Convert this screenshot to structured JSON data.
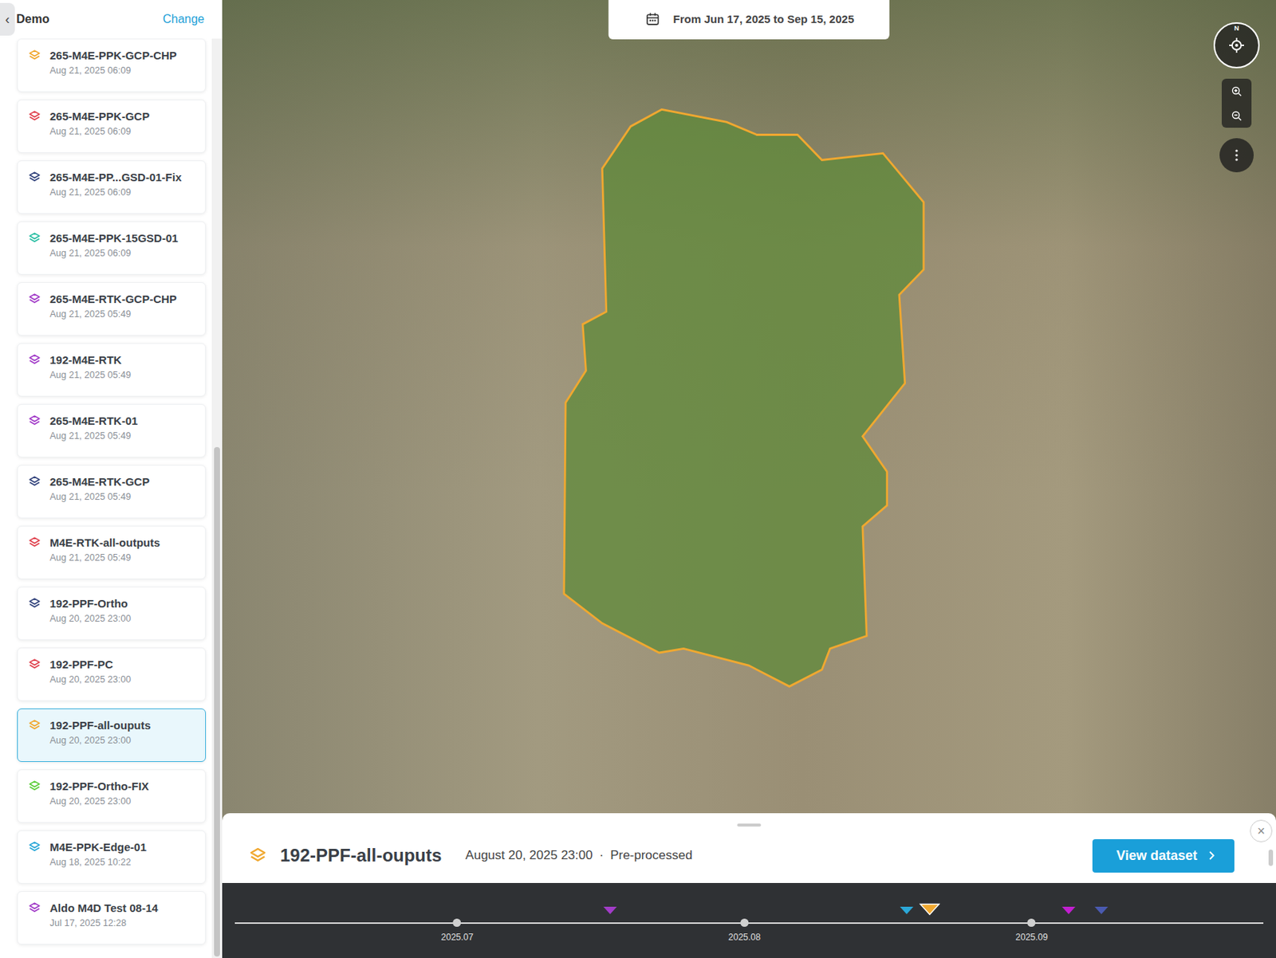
{
  "sidebar": {
    "title": "Demo",
    "action": "Change",
    "collapse": "‹"
  },
  "datasets": [
    {
      "title": "265-M4E-PPK-GCP-CHP",
      "date": "Aug 21, 2025 06:09",
      "color": "#f0a830",
      "selected": false
    },
    {
      "title": "265-M4E-PPK-GCP",
      "date": "Aug 21, 2025 06:09",
      "color": "#e0434f",
      "selected": false
    },
    {
      "title": "265-M4E-PP...GSD-01-Fix",
      "date": "Aug 21, 2025 06:09",
      "color": "#34457d",
      "selected": false
    },
    {
      "title": "265-M4E-PPK-15GSD-01",
      "date": "Aug 21, 2025 06:09",
      "color": "#2bbfa4",
      "selected": false
    },
    {
      "title": "265-M4E-RTK-GCP-CHP",
      "date": "Aug 21, 2025 05:49",
      "color": "#a23cc8",
      "selected": false
    },
    {
      "title": "192-M4E-RTK",
      "date": "Aug 21, 2025 05:49",
      "color": "#a23cc8",
      "selected": false
    },
    {
      "title": "265-M4E-RTK-01",
      "date": "Aug 21, 2025 05:49",
      "color": "#a23cc8",
      "selected": false
    },
    {
      "title": "265-M4E-RTK-GCP",
      "date": "Aug 21, 2025 05:49",
      "color": "#34457d",
      "selected": false
    },
    {
      "title": "M4E-RTK-all-outputs",
      "date": "Aug 21, 2025 05:49",
      "color": "#e0434f",
      "selected": false
    },
    {
      "title": "192-PPF-Ortho",
      "date": "Aug 20, 2025 23:00",
      "color": "#34457d",
      "selected": false
    },
    {
      "title": "192-PPF-PC",
      "date": "Aug 20, 2025 23:00",
      "color": "#e0434f",
      "selected": false
    },
    {
      "title": "192-PPF-all-ouputs",
      "date": "Aug 20, 2025 23:00",
      "color": "#f0a830",
      "selected": true
    },
    {
      "title": "192-PPF-Ortho-FIX",
      "date": "Aug 20, 2025 23:00",
      "color": "#5fcf3c",
      "selected": false
    },
    {
      "title": "M4E-PPK-Edge-01",
      "date": "Aug 18, 2025 10:22",
      "color": "#2ba8d8",
      "selected": false
    },
    {
      "title": "Aldo M4D Test 08-14",
      "date": "Jul 17, 2025 12:28",
      "color": "#a23cc8",
      "selected": false
    }
  ],
  "date_range": "From Jun 17, 2025 to Sep 15, 2025",
  "compass": "N",
  "detail": {
    "title": "192-PPF-all-ouputs",
    "date": "August 20, 2025 23:00",
    "separator": "·",
    "status": "Pre-processed",
    "button": "View dataset",
    "close": "×",
    "color": "#f0a830"
  },
  "timeline": {
    "span_days": 111,
    "ticks": [
      {
        "label": "2025.07",
        "day": 24
      },
      {
        "label": "2025.08",
        "day": 55
      },
      {
        "label": "2025.09",
        "day": 86
      }
    ],
    "markers": [
      {
        "day": 40.5,
        "color": "#a23cc8",
        "selected": false
      },
      {
        "day": 72.5,
        "color": "#2ba8d8",
        "selected": false
      },
      {
        "day": 75,
        "color": "#f0a830",
        "selected": true
      },
      {
        "day": 90,
        "color": "#c21fd0",
        "selected": false
      },
      {
        "day": 93.5,
        "color": "#4a5ab0",
        "selected": false
      }
    ]
  }
}
